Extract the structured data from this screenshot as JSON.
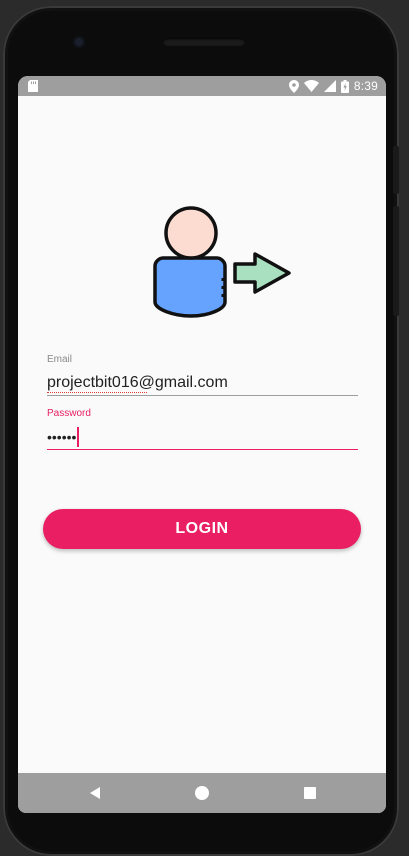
{
  "status_bar": {
    "time": "8:39",
    "icons": [
      "sd-card-icon",
      "location-icon",
      "wifi-icon",
      "signal-icon",
      "battery-icon"
    ]
  },
  "hero": {
    "icon": "user-login-icon",
    "colors": {
      "head": "#fcdcd1",
      "body": "#66a3ff",
      "arrow": "#a8e0c0",
      "outline": "#111111"
    }
  },
  "form": {
    "email": {
      "label": "Email",
      "value": "projectbit016@gmail.com"
    },
    "password": {
      "label": "Password",
      "value": "••••••"
    }
  },
  "login_button": {
    "label": "LOGIN"
  },
  "nav_bar": {
    "buttons": [
      "back-icon",
      "home-icon",
      "recents-icon"
    ]
  },
  "theme": {
    "accent": "#e91e63",
    "screen_background": "#fafafa",
    "system_bars": "#9e9e9e"
  }
}
